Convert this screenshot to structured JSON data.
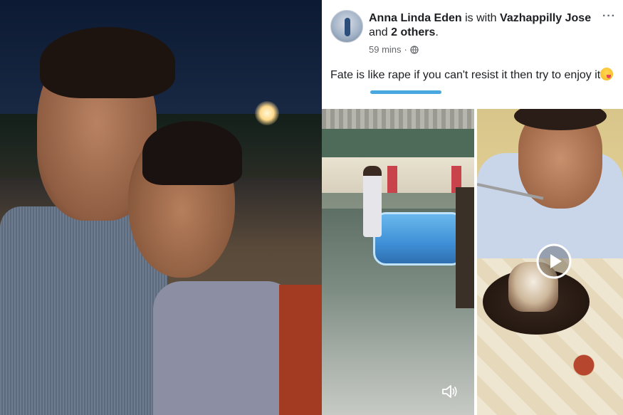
{
  "post": {
    "author": "Anna Linda Eden",
    "with_text": "is with",
    "tagged_name": "Vazhappilly Jose",
    "and_text": "and",
    "others": "2 others",
    "period": ".",
    "time": "59 mins",
    "separator": "·",
    "privacy_icon": "globe-icon",
    "more_label": "···",
    "text": "Fate is like rape if you can't resist it then try to enjoy it",
    "emoji_icon": "winking-tongue-emoji-icon"
  },
  "media": {
    "video1_icon": "speaker-icon",
    "video2_icon": "play-icon"
  },
  "colors": {
    "underline_mark": "#4aa8e0",
    "text_primary": "#1c1e21",
    "text_meta": "#65676b"
  }
}
